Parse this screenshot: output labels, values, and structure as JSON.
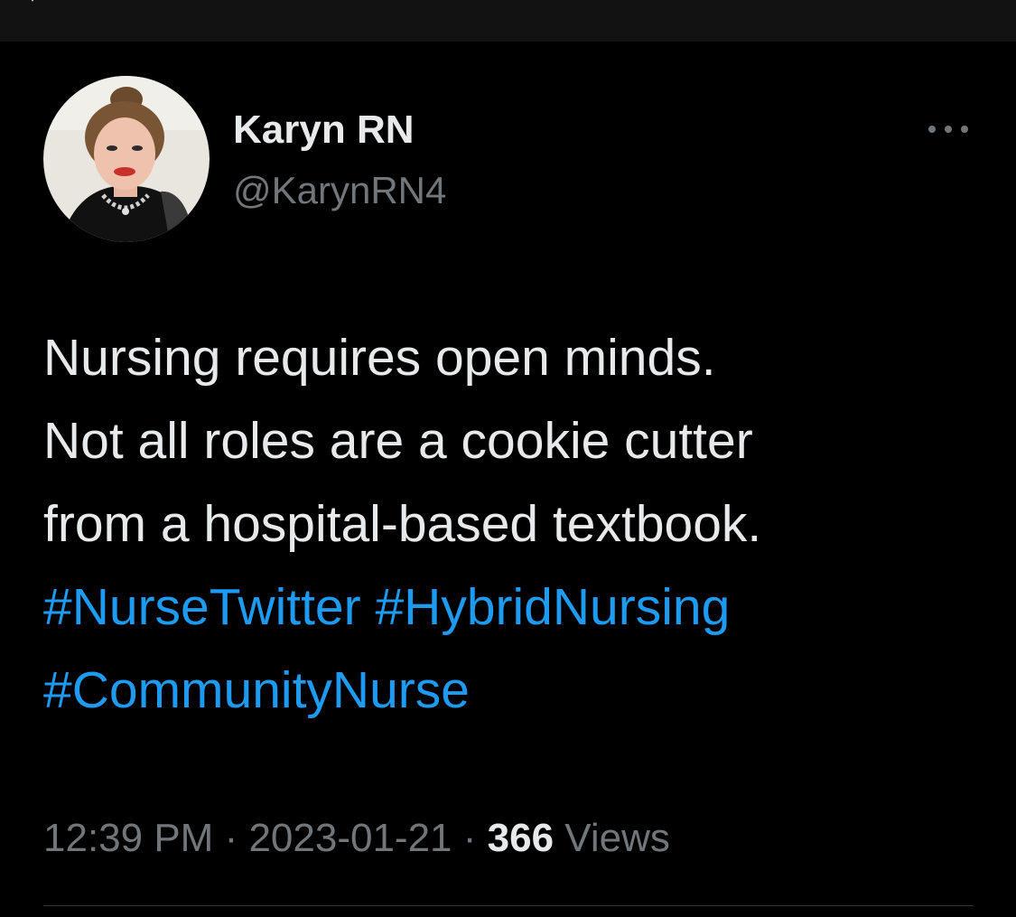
{
  "header": {
    "back_icon": "chevron-left-icon"
  },
  "tweet": {
    "author": {
      "display_name": "Karyn RN",
      "handle": "@KarynRN4",
      "avatar_icon": "avatar-photo"
    },
    "more_icon": "more-horizontal-icon",
    "text_lines": [
      "Nursing requires open minds.",
      "Not all roles are a cookie cutter",
      "from a hospital-based textbook."
    ],
    "hashtags": [
      "#NurseTwitter",
      "#HybridNursing",
      "#CommunityNurse"
    ],
    "time": "12:39 PM",
    "separator": " · ",
    "date": "2023-01-21",
    "views_count": "366",
    "views_label": " Views"
  },
  "colors": {
    "background": "#000000",
    "text": "#e7e9ea",
    "secondary_text": "#71767b",
    "link": "#1d9bf0",
    "divider": "#2f3336"
  }
}
